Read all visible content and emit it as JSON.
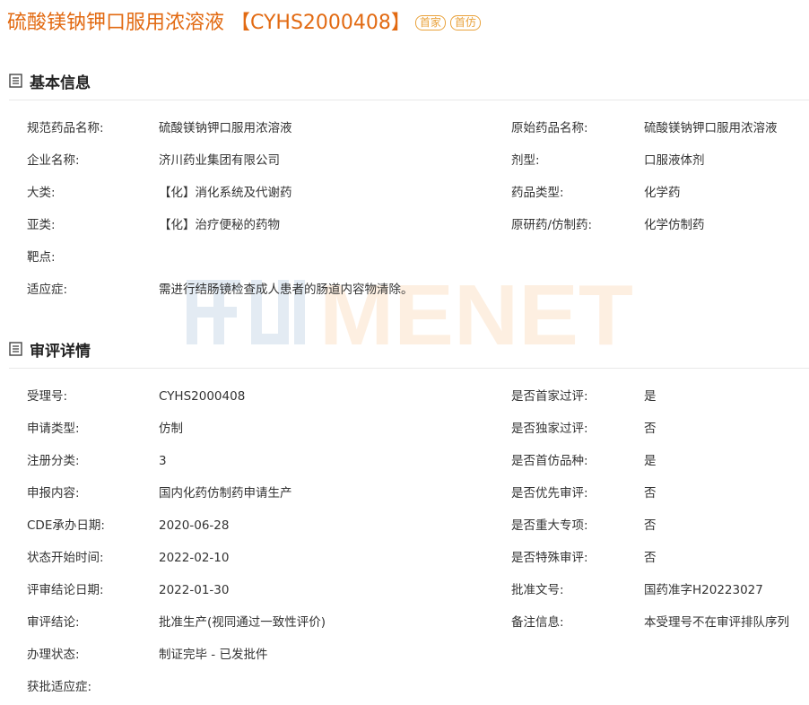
{
  "header": {
    "title": "硫酸镁钠钾口服用浓溶液 【CYHS2000408】",
    "badges": [
      "首家",
      "首仿"
    ]
  },
  "watermark_text": "MENET",
  "basic_info": {
    "title": "基本信息",
    "icon": "document-list-icon",
    "rows": [
      {
        "left_label": "规范药品名称:",
        "left_value": "硫酸镁钠钾口服用浓溶液",
        "right_label": "原始药品名称:",
        "right_value": "硫酸镁钠钾口服用浓溶液"
      },
      {
        "left_label": "企业名称:",
        "left_value": "济川药业集团有限公司",
        "right_label": "剂型:",
        "right_value": "口服液体剂"
      },
      {
        "left_label": "大类:",
        "left_value": "【化】消化系统及代谢药",
        "right_label": "药品类型:",
        "right_value": "化学药"
      },
      {
        "left_label": "亚类:",
        "left_value": "【化】治疗便秘的药物",
        "right_label": "原研药/仿制药:",
        "right_value": "化学仿制药"
      },
      {
        "left_label": "靶点:",
        "left_value": "",
        "right_label": "",
        "right_value": ""
      },
      {
        "left_label": "适应症:",
        "left_value": "需进行结肠镜检查成人患者的肠道内容物清除。",
        "right_label": "",
        "right_value": ""
      }
    ]
  },
  "review_details": {
    "title": "审评详情",
    "icon": "document-list-icon",
    "rows": [
      {
        "left_label": "受理号:",
        "left_value": "CYHS2000408",
        "right_label": "是否首家过评:",
        "right_value": "是"
      },
      {
        "left_label": "申请类型:",
        "left_value": "仿制",
        "right_label": "是否独家过评:",
        "right_value": "否"
      },
      {
        "left_label": "注册分类:",
        "left_value": "3",
        "right_label": "是否首仿品种:",
        "right_value": "是"
      },
      {
        "left_label": "申报内容:",
        "left_value": "国内化药仿制药申请生产",
        "right_label": "是否优先审评:",
        "right_value": "否"
      },
      {
        "left_label": "CDE承办日期:",
        "left_value": "2020-06-28",
        "right_label": "是否重大专项:",
        "right_value": "否"
      },
      {
        "left_label": "状态开始时间:",
        "left_value": "2022-02-10",
        "right_label": "是否特殊审评:",
        "right_value": "否"
      },
      {
        "left_label": "评审结论日期:",
        "left_value": "2022-01-30",
        "right_label": "批准文号:",
        "right_value": "国药准字H20223027"
      },
      {
        "left_label": "审评结论:",
        "left_value": "批准生产(视同通过一致性评价)",
        "right_label": "备注信息:",
        "right_value": "本受理号不在审评排队序列"
      },
      {
        "left_label": "办理状态:",
        "left_value": "制证完毕 - 已发批件",
        "right_label": "",
        "right_value": ""
      },
      {
        "left_label": "获批适应症:",
        "left_value": "",
        "right_label": "",
        "right_value": ""
      }
    ]
  },
  "colors": {
    "title": "#e26a12",
    "badge": "#e9a23b",
    "watermark_blue": "#2f6fa8",
    "watermark_orange": "#f08a24"
  }
}
